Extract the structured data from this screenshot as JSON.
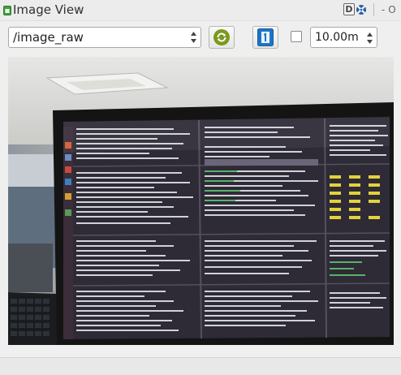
{
  "window": {
    "title": "Image View",
    "buttons": {
      "d_label": "D",
      "dash": "-",
      "o_label": "O"
    }
  },
  "toolbar": {
    "topic": "/image_raw",
    "smooth_checked": false,
    "max_range": "10.00m"
  },
  "icons": {
    "title": "plugin-icon",
    "refresh": "refresh-icon",
    "save": "save-icon",
    "help": "help-icon"
  },
  "colors": {
    "refresh_green": "#7a9a1e",
    "save_blue": "#1d74c9",
    "monitor_bezel": "#141414",
    "terminal_bg": "#2e2a36"
  }
}
